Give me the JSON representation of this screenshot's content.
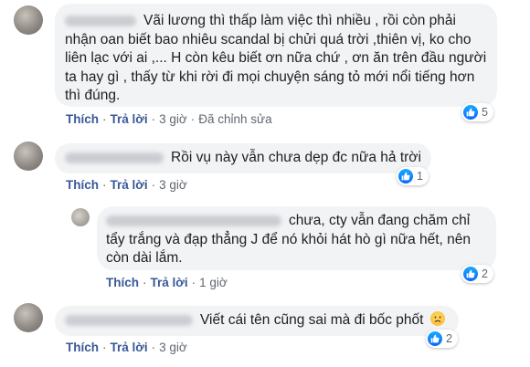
{
  "comments": [
    {
      "lines": [
        "Vãi lương thì thấp làm việc thì nhiều , rồi còn phải",
        "nhận oan biết bao nhiêu scandal bị chửi quá trời ,thiên vị, ko cho",
        "liên lạc với ai ,... H còn kêu biết ơn nữa chứ , ơn ăn trên đầu người",
        "ta hay gì , thấy từ khi rời đi mọi chuyện sáng tỏ mới nổi tiếng hơn",
        "thì đúng."
      ],
      "like_label": "Thích",
      "reply_label": "Trả lời",
      "time": "3 giờ",
      "edited": "Đã chỉnh sửa",
      "reaction_count": "5"
    },
    {
      "lines": [
        "Rồi vụ này vẫn chưa dẹp đc nữa hả trời"
      ],
      "like_label": "Thích",
      "reply_label": "Trả lời",
      "time": "3 giờ",
      "reaction_count": "1"
    },
    {
      "lines": [
        "chưa, cty vẫn đang chăm chỉ",
        "tẩy trắng và đạp thẳng J để nó khỏi hát hò gì nữa hết, nên",
        "còn dài lắm."
      ],
      "like_label": "Thích",
      "reply_label": "Trả lời",
      "time": "1 giờ",
      "reaction_count": "2"
    },
    {
      "lines": [
        "Viết cái tên cũng sai mà đi bốc phốt"
      ],
      "emoji": "😞",
      "like_label": "Thích",
      "reply_label": "Trả lời",
      "time": "3 giờ",
      "reaction_count": "2"
    }
  ],
  "colors": {
    "bubble": "#f2f3f5",
    "link": "#385898",
    "meta": "#606770",
    "like_blue": "#0866ff"
  },
  "icons": [
    "like-icon",
    "sad-face-emoji"
  ]
}
